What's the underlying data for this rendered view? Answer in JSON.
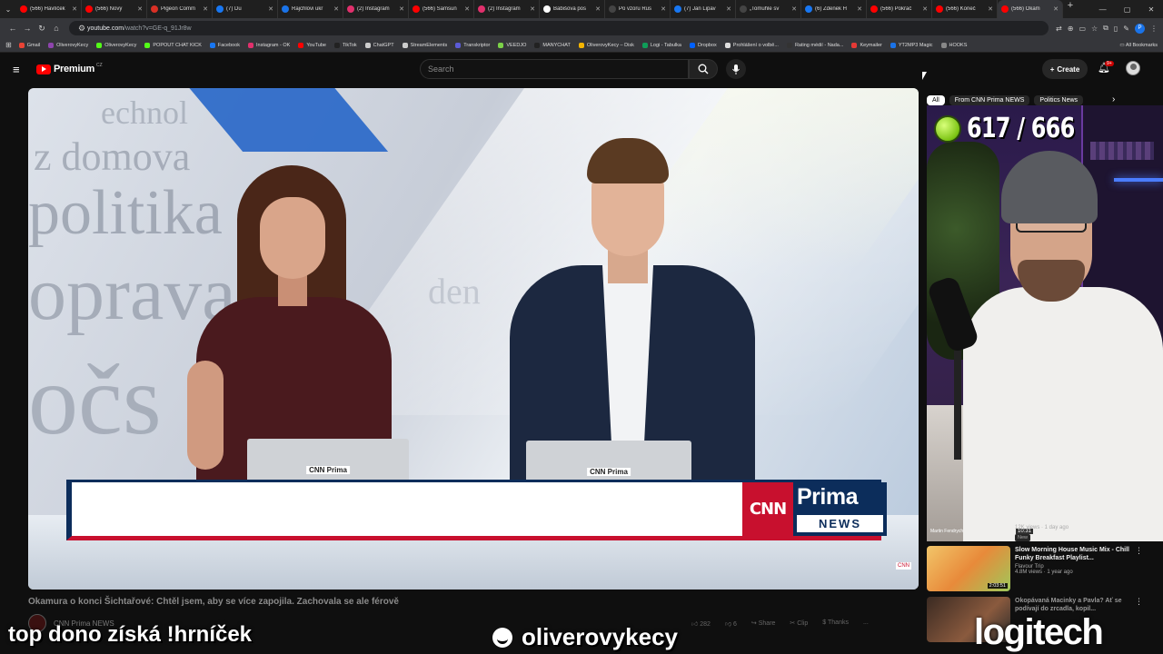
{
  "browser": {
    "tabs": [
      {
        "label": "(566) Havlíček",
        "color": "#ff0000"
      },
      {
        "label": "(566) Nový",
        "color": "#ff0000"
      },
      {
        "label": "Pigeon Comm",
        "color": "#d93025"
      },
      {
        "label": "(7) Du",
        "color": "#1877f2"
      },
      {
        "label": "Rajchlovi ukr",
        "color": "#1a73e8"
      },
      {
        "label": "(2) Instagram",
        "color": "#e1306c"
      },
      {
        "label": "(566) Samsun",
        "color": "#ff0000"
      },
      {
        "label": "(2) Instagram",
        "color": "#e1306c"
      },
      {
        "label": "Babišova pos",
        "color": "#ffffff"
      },
      {
        "label": "Po vzoru Rus",
        "color": "#444444"
      },
      {
        "label": "(7) Jan Lipav",
        "color": "#1877f2"
      },
      {
        "label": "„Tomuhle sv",
        "color": "#444444"
      },
      {
        "label": "(6) Zdenek H",
        "color": "#1877f2"
      },
      {
        "label": "(566) Pokrač",
        "color": "#ff0000"
      },
      {
        "label": "(566) Koneč",
        "color": "#ff0000"
      },
      {
        "label": "(566) Okam",
        "color": "#ff0000"
      }
    ],
    "url_host": "youtube.com",
    "url_path": "/watch?v=GE-q_91Jr8w",
    "profile_initial": "P",
    "bookmarks": [
      {
        "label": "Gmail",
        "color": "#ea4335"
      },
      {
        "label": "OliverovyKecy",
        "color": "#8e44ad"
      },
      {
        "label": "OliverovyKecy",
        "color": "#53fc18"
      },
      {
        "label": "POPOUT CHAT KICK",
        "color": "#53fc18"
      },
      {
        "label": "Facebook",
        "color": "#1877f2"
      },
      {
        "label": "Instagram - OK",
        "color": "#e1306c"
      },
      {
        "label": "YouTube",
        "color": "#ff0000"
      },
      {
        "label": "TikTok",
        "color": "#222222"
      },
      {
        "label": "ChatGPT",
        "color": "#cccccc"
      },
      {
        "label": "StreamElements",
        "color": "#cccccc"
      },
      {
        "label": "Transkriptor",
        "color": "#5b5bd6"
      },
      {
        "label": "VEEDJO",
        "color": "#7bd148"
      },
      {
        "label": "MANYCHAT",
        "color": "#222222"
      },
      {
        "label": "OliverovyKecy – Disk",
        "color": "#f4b400"
      },
      {
        "label": "Logi - Tabulka",
        "color": "#0f9d58"
      },
      {
        "label": "Dropbox",
        "color": "#0061ff"
      },
      {
        "label": "Prohlášení o volbě...",
        "color": "#dddddd"
      },
      {
        "label": "Rating médií - Nada...",
        "color": "#333333"
      },
      {
        "label": "Keymailer",
        "color": "#e53935"
      },
      {
        "label": "YT2MP3 Magic",
        "color": "#1a73e8"
      },
      {
        "label": "HOOKS",
        "color": "#888888"
      }
    ],
    "all_bookmarks": "All Bookmarks"
  },
  "youtube": {
    "logo_word": "Premium",
    "logo_country": "CZ",
    "search_placeholder": "Search",
    "create_label": "Create",
    "notif_badge": "9+",
    "video": {
      "lowerthird_cnn": "CNN",
      "lowerthird_prima": "Prima",
      "lowerthird_news": "NEWS",
      "laptop_logo": "CNN Prima",
      "corner_logo": "CNN"
    },
    "video_title": "Okamura o konci Šichtařové: Chtěl jsem, aby se více zapojila. Zachovala se ale férově",
    "channel_name": "CNN Prima NEWS",
    "actions": {
      "likes": "282",
      "dislike": "6",
      "share": "Share",
      "clip": "Clip",
      "thanks": "Thanks",
      "more": "..."
    },
    "chips": [
      "All",
      "From CNN Prima NEWS",
      "Politics News"
    ],
    "webcam_counter": "617 / 666",
    "webcam_tag": "Martin Fendrych",
    "webcam_duration": "10:31",
    "partial_meta": "12K views · 1 day ago",
    "new_badge": "New",
    "recs": [
      {
        "title": "Slow Morning House Music Mix - Chill Funky Breakfast Playlist...",
        "channel": "Flavour Trip",
        "meta": "4.8M views · 1 year ago",
        "duration": "2:03:51"
      },
      {
        "title": "Okopávaná Macinky a Pavla? Ať se podívají do zrcadla, kopil...",
        "channel": "",
        "meta": "",
        "duration": ""
      }
    ]
  },
  "overlay": {
    "left_text": "top dono získá !hrníček",
    "handle": "oliverovykecy",
    "sponsor": "logitech"
  }
}
